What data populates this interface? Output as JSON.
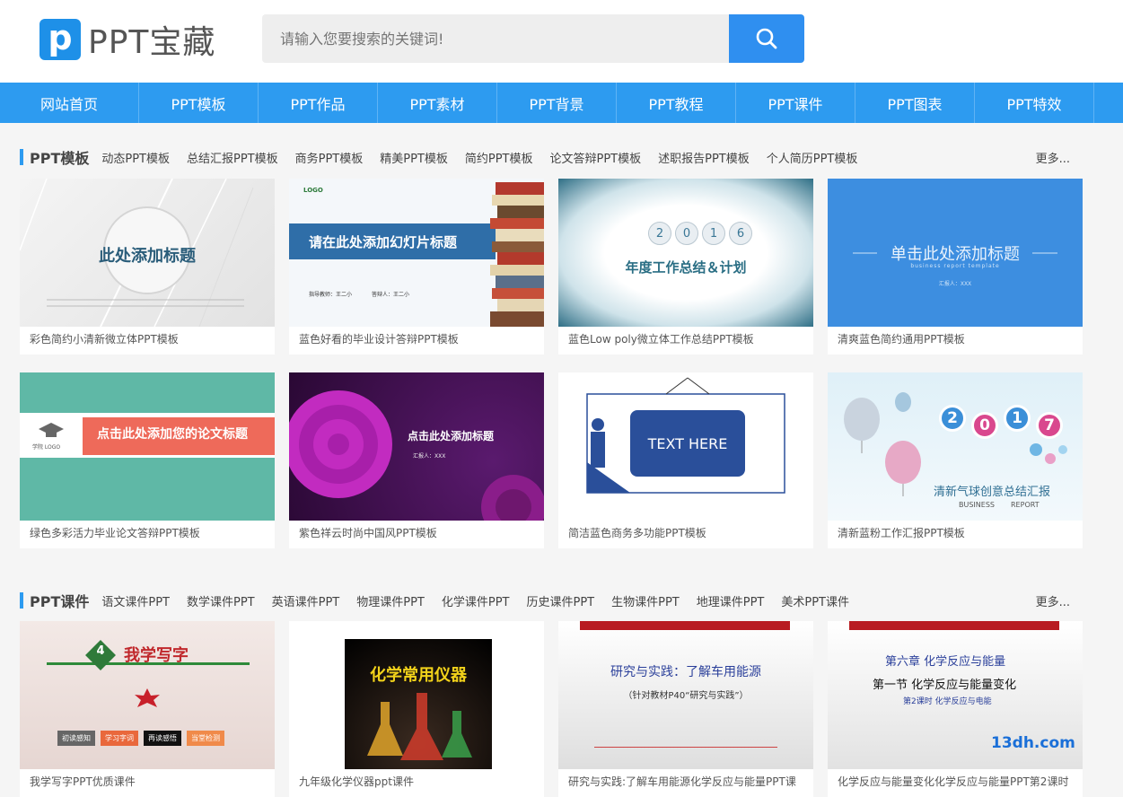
{
  "logo": {
    "text": "PPT宝藏",
    "mark": "p"
  },
  "search": {
    "placeholder": "请输入您要搜索的关键词!"
  },
  "nav": [
    "网站首页",
    "PPT模板",
    "PPT作品",
    "PPT素材",
    "PPT背景",
    "PPT教程",
    "PPT课件",
    "PPT图表",
    "PPT特效"
  ],
  "sections": [
    {
      "title": "PPT模板",
      "tags": [
        "动态PPT模板",
        "总结汇报PPT模板",
        "商务PPT模板",
        "精美PPT模板",
        "简约PPT模板",
        "论文答辩PPT模板",
        "述职报告PPT模板",
        "个人简历PPT模板"
      ],
      "more": "更多...",
      "cards": [
        {
          "caption": "彩色简约小清新微立体PPT模板",
          "thumb_text": "此处添加标题"
        },
        {
          "caption": "蓝色好看的毕业设计答辩PPT模板",
          "thumb_text": "请在此处添加幻灯片标题",
          "logo": "LOGO",
          "author1": "指导教师：王二小",
          "author2": "答辩人：王二小"
        },
        {
          "caption": "蓝色Low poly微立体工作总结PPT模板",
          "year": [
            "2",
            "0",
            "1",
            "6"
          ],
          "thumb_text": "年度工作总结＆计划"
        },
        {
          "caption": "清爽蓝色简约通用PPT模板",
          "thumb_text": "单击此处添加标题",
          "sub": "business report template",
          "reporter": "汇报人：XXX"
        },
        {
          "caption": "绿色多彩活力毕业论文答辩PPT模板",
          "thumb_text": "点击此处添加您的论文标题",
          "logo": "学院 LOGO"
        },
        {
          "caption": "紫色祥云时尚中国风PPT模板",
          "thumb_text": "点击此处添加标题",
          "reporter": "汇报人：XXX"
        },
        {
          "caption": "简洁蓝色商务多功能PPT模板",
          "thumb_text": "TEXT HERE"
        },
        {
          "caption": "清新蓝粉工作汇报PPT模板",
          "year": [
            "2",
            "0",
            "1",
            "7"
          ],
          "thumb_text": "清新气球创意总结汇报",
          "sub1": "BUSINESS",
          "sub2": "REPORT"
        }
      ]
    },
    {
      "title": "PPT课件",
      "tags": [
        "语文课件PPT",
        "数学课件PPT",
        "英语课件PPT",
        "物理课件PPT",
        "化学课件PPT",
        "历史课件PPT",
        "生物课件PPT",
        "地理课件PPT",
        "美术PPT课件"
      ],
      "more": "更多...",
      "cards": [
        {
          "caption": "我学写字PPT优质课件",
          "num": "4",
          "thumb_text": "我学写字",
          "chips": [
            "初读感知",
            "学习字词",
            "再读感悟",
            "当堂检测"
          ]
        },
        {
          "caption": "九年级化学仪器ppt课件",
          "thumb_text": "化学常用仪器"
        },
        {
          "caption": "研究与实践:了解车用能源化学反应与能量PPT课",
          "thumb_text": "研究与实践：了解车用能源",
          "sub": "（针对教材P40“研究与实践”）"
        },
        {
          "caption": "化学反应与能量变化化学反应与能量PPT第2课时",
          "line1": "第六章   化学反应与能量",
          "line2": "第一节   化学反应与能量变化",
          "line3": "第2课时 化学反应与电能",
          "watermark": "13dh.com"
        }
      ]
    }
  ],
  "colors": {
    "accent": "#2d9bf0",
    "search_btn": "#2f8ff0"
  },
  "icons": {
    "search": "search-icon"
  }
}
